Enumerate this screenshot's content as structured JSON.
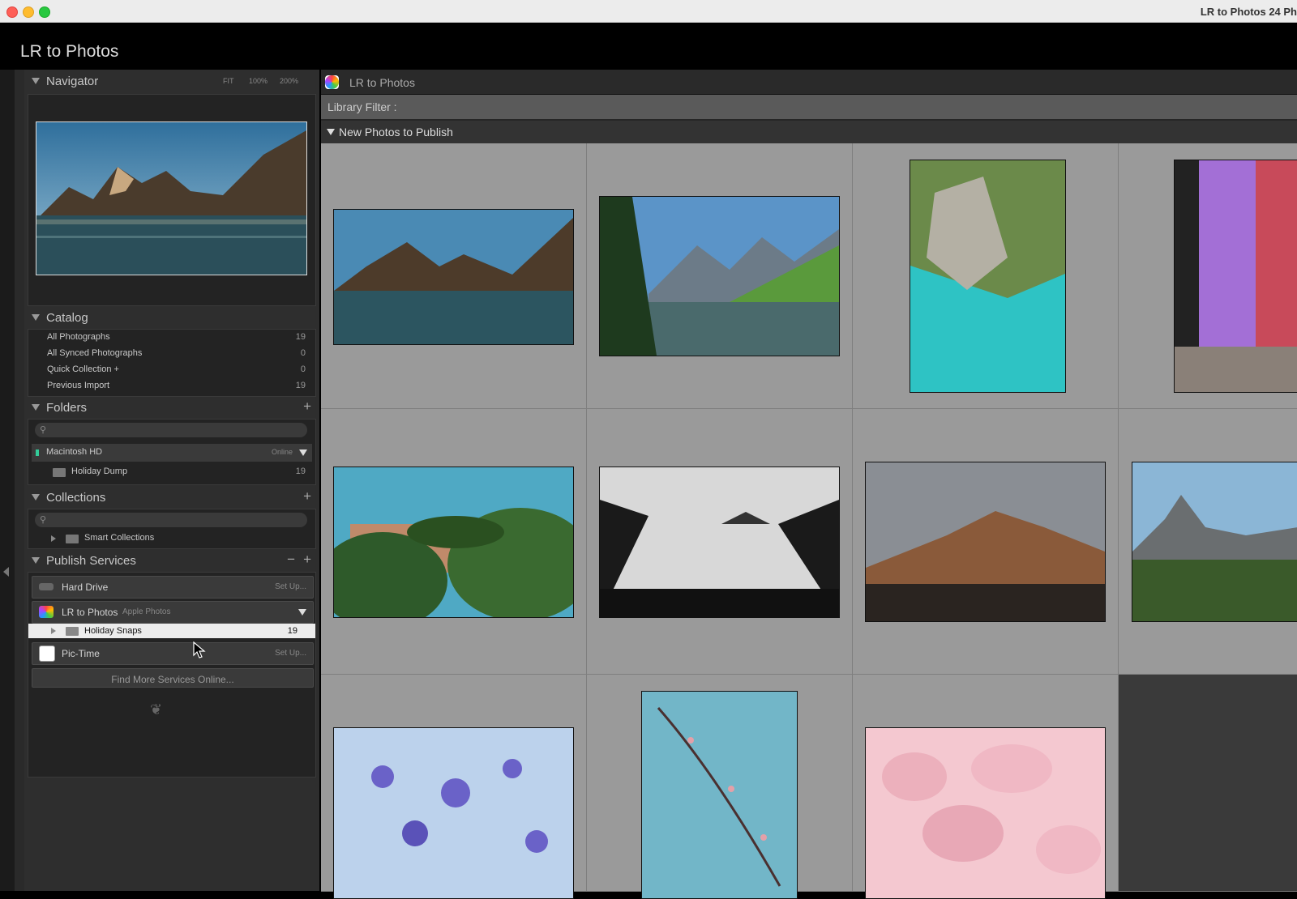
{
  "window": {
    "title": "LR to Photos 24 Ph"
  },
  "app": {
    "title": "LR to Photos"
  },
  "navigator": {
    "title": "Navigator",
    "zoom_fit": "FIT",
    "zoom_100": "100%",
    "zoom_200": "200%"
  },
  "catalog": {
    "title": "Catalog",
    "items": [
      {
        "label": "All Photographs",
        "count": "19"
      },
      {
        "label": "All Synced Photographs",
        "count": "0"
      },
      {
        "label": "Quick Collection +",
        "count": "0"
      },
      {
        "label": "Previous Import",
        "count": "19"
      }
    ]
  },
  "folders": {
    "title": "Folders",
    "volume": {
      "label": "Macintosh HD",
      "status": "Online"
    },
    "items": [
      {
        "label": "Holiday Dump",
        "count": "19"
      }
    ]
  },
  "collections": {
    "title": "Collections",
    "items": [
      {
        "label": "Smart Collections"
      }
    ]
  },
  "publish": {
    "title": "Publish Services",
    "hard_drive": {
      "label": "Hard Drive",
      "action": "Set Up..."
    },
    "lr_photos": {
      "label": "LR to Photos",
      "sub": "Apple Photos"
    },
    "holiday_snaps": {
      "label": "Holiday Snaps",
      "count": "19"
    },
    "pictime": {
      "label": "Pic-Time",
      "action": "Set Up..."
    },
    "find_more": "Find More Services Online..."
  },
  "main": {
    "title": "LR to Photos",
    "filter_label": "Library Filter :",
    "group_title": "New Photos to Publish"
  },
  "colors": {
    "panel": "#2e2e2e",
    "grid": "#9a9a9a",
    "accent": "#fe5f57"
  }
}
